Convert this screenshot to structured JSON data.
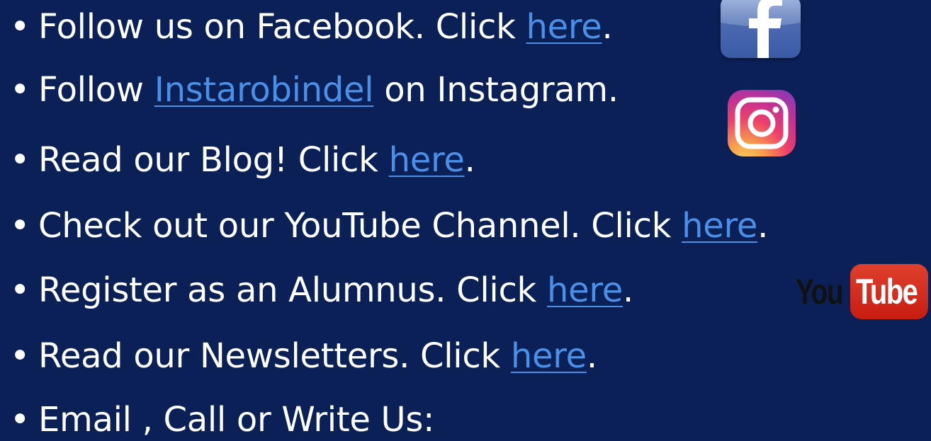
{
  "slide": {
    "bullets": [
      {
        "pre": "Follow us on Facebook. Click ",
        "link": "here",
        "post": "."
      },
      {
        "pre": "Follow ",
        "link": "Instarobindel",
        "post": " on Instagram."
      },
      {
        "pre": "Read our Blog! Click ",
        "link": "here",
        "post": "."
      },
      {
        "pre": "Check out our YouTube Channel. Click ",
        "link": "here",
        "post": "."
      },
      {
        "pre": "Register as an Alumnus. Click ",
        "link": "here",
        "post": "."
      },
      {
        "pre": "Read our Newsletters. Click ",
        "link": "here",
        "post": "."
      },
      {
        "pre": "Email , Call or Write Us:"
      }
    ],
    "bullet_symbol": "•"
  },
  "icons": {
    "facebook": "facebook-icon",
    "instagram": "instagram-icon",
    "youtube": {
      "name": "youtube-logo",
      "you": "You",
      "tube": "Tube"
    }
  },
  "colors": {
    "background": "#0b2057",
    "text": "#ffffff",
    "link": "#4a8fe8",
    "youtube_red": "#c71d12"
  }
}
